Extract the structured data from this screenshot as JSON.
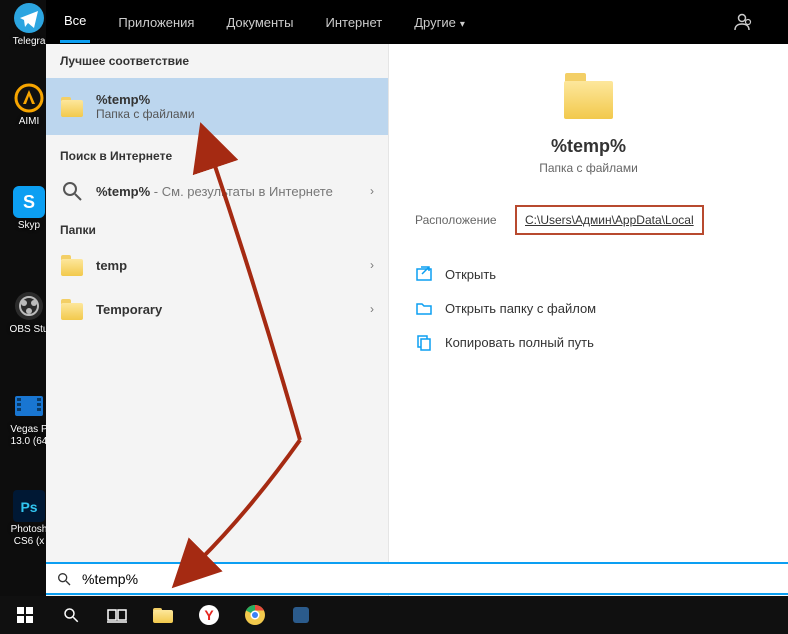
{
  "desktop_icons": [
    {
      "label": "Telegra"
    },
    {
      "label": "AIMI"
    },
    {
      "label": "Skyp"
    },
    {
      "label": "OBS Stu"
    },
    {
      "label": "Vegas P\n13.0 (64"
    },
    {
      "label": "Photosh\nCS6 (x"
    }
  ],
  "tabs": {
    "all": "Все",
    "apps": "Приложения",
    "docs": "Документы",
    "web": "Интернет",
    "other": "Другие"
  },
  "sections": {
    "best_match": "Лучшее соответствие",
    "web_search": "Поиск в Интернете",
    "folders": "Папки"
  },
  "best_result": {
    "title": "%temp%",
    "subtitle": "Папка с файлами"
  },
  "web_result": {
    "query": "%temp%",
    "suffix": " - См. результаты в Интернете"
  },
  "folder_results": [
    "temp",
    "Temporary"
  ],
  "preview": {
    "title": "%temp%",
    "subtitle": "Папка с файлами",
    "location_label": "Расположение",
    "location_value": "C:\\Users\\Админ\\AppData\\Local"
  },
  "actions": {
    "open": "Открыть",
    "open_container": "Открыть папку с файлом",
    "copy_path": "Копировать полный путь"
  },
  "search_value": "%temp%",
  "colors": {
    "accent": "#0c9ff2",
    "highlight_box": "#b84a2f"
  }
}
